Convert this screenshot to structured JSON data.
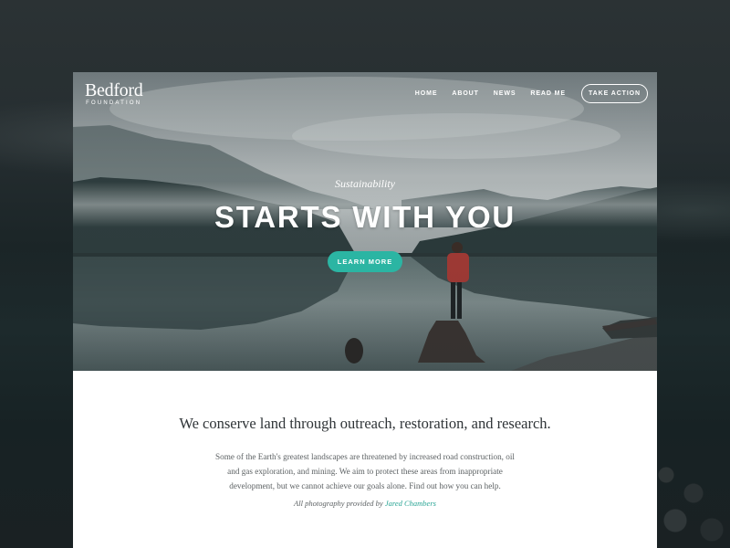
{
  "logo": {
    "name": "Bedford",
    "subtitle": "FOUNDATION"
  },
  "nav": {
    "links": [
      "HOME",
      "ABOUT",
      "NEWS",
      "READ ME"
    ],
    "cta_label": "TAKE ACTION"
  },
  "hero": {
    "kicker": "Sustainability",
    "title": "STARTS WITH YOU",
    "button_label": "LEARN MORE"
  },
  "intro": {
    "headline": "We conserve land through outreach, restoration, and research.",
    "paragraph": "Some of the Earth's greatest landscapes are threatened by increased road construction, oil and gas exploration, and mining. We aim to protect these areas from inappropriate development, but we cannot achieve our goals alone. Find out how you can help.",
    "credit_prefix": "All photography provided by",
    "credit_name": "Jared Chambers"
  },
  "colors": {
    "accent": "#2bb5a3",
    "text_dark": "#2f3437",
    "text_body": "#5c6163",
    "backdrop": "#20292b"
  }
}
